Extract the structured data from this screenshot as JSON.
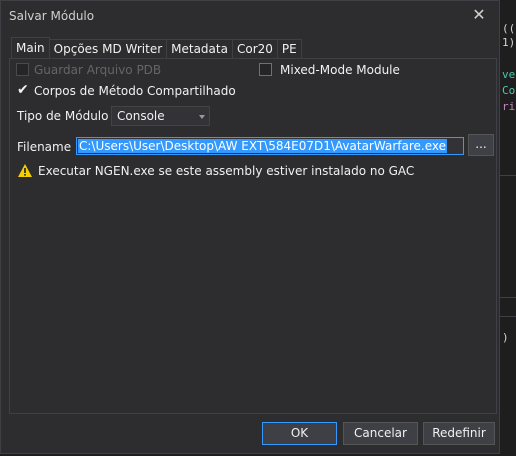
{
  "window": {
    "title": "Salvar Módulo",
    "close_label": "✕"
  },
  "tabs": [
    {
      "label": "Main",
      "active": true
    },
    {
      "label": "Opções MD Writer",
      "active": false
    },
    {
      "label": "Metadata",
      "active": false
    },
    {
      "label": "Cor20",
      "active": false
    },
    {
      "label": "PE",
      "active": false
    }
  ],
  "main": {
    "pdb": {
      "label": "Guardar Arquivo PDB",
      "checked": false,
      "enabled": false
    },
    "mixed_mode": {
      "label": "Mixed-Mode Module",
      "checked": false
    },
    "shared_bodies": {
      "label": "Corpos de Método Compartilhado",
      "checked": true
    },
    "module_type": {
      "label": "Tipo de Módulo",
      "value": "Console"
    },
    "filename": {
      "label": "Filename",
      "value": "C:\\Users\\User\\Desktop\\AW EXT\\584E07D1\\AvatarWarfare.exe",
      "browse_label": "..."
    },
    "ngen_warning": "Executar NGEN.exe se este assembly estiver instalado no GAC"
  },
  "buttons": {
    "ok": "OK",
    "cancel": "Cancelar",
    "reset": "Redefinir"
  },
  "background_code": {
    "lines": [
      "((",
      "1)",
      "ver",
      "Col",
      "rin"
    ],
    "tail": ") C"
  },
  "colors": {
    "dialog_bg": "#2d2d30",
    "accent": "#3399ff",
    "warning": "#f5d000"
  }
}
